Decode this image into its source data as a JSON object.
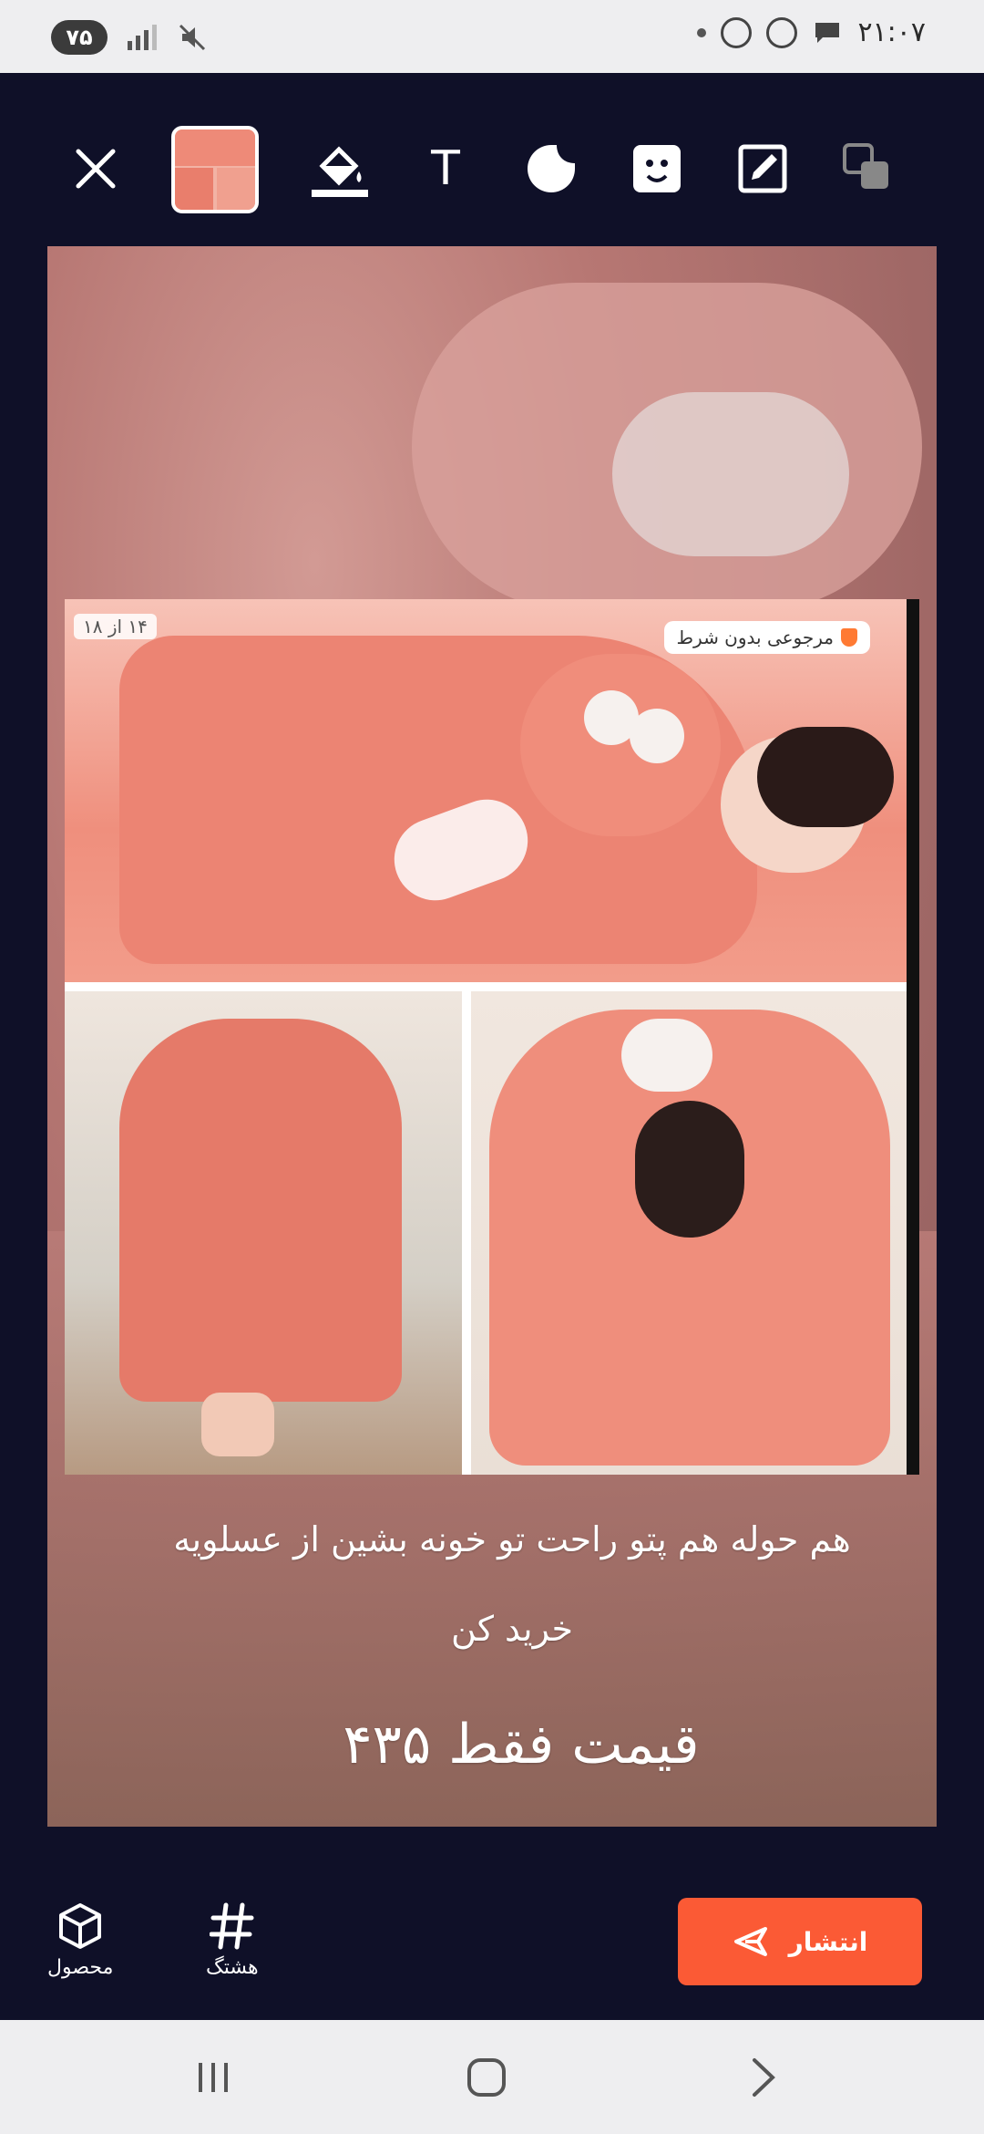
{
  "status_bar": {
    "battery": "۷۵",
    "time": "۲۱:۰۷"
  },
  "toolbar": {
    "text_tool_glyph": "T",
    "tools": [
      "close-icon",
      "image-thumbnail",
      "fill-icon",
      "text-tool",
      "sticker-icon",
      "face-sticker-icon",
      "edit-icon",
      "layers-icon"
    ]
  },
  "canvas": {
    "page_counter": "۱۴ از ۱۸",
    "return_badge": "مرجوعی بدون شرط",
    "caption_line1": "هم حوله هم پتو  راحت تو خونه بشین از عسلویه",
    "caption_line2": "خرید کن",
    "caption_line3": "قیمت فقط ۴۳۵"
  },
  "bottom_bar": {
    "product_label": "محصول",
    "hashtag_label": "هشتگ",
    "publish_label": "انتشار",
    "accent_color": "#fb5a35"
  }
}
